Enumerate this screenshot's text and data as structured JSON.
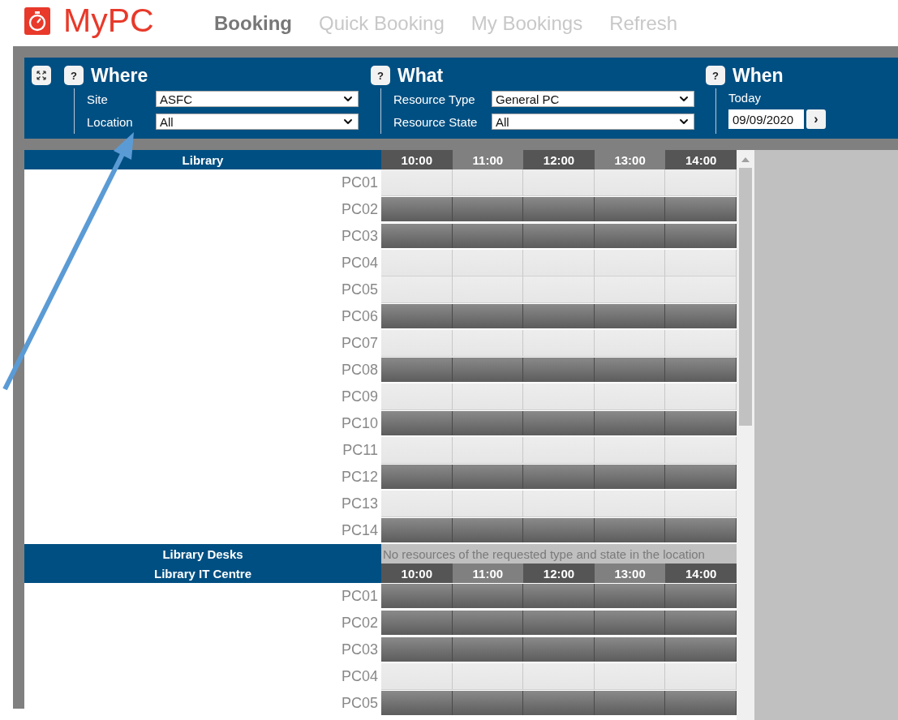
{
  "logo": {
    "text": "MyPC"
  },
  "nav": [
    {
      "label": "Booking",
      "selected": true
    },
    {
      "label": "Quick Booking",
      "selected": false
    },
    {
      "label": "My Bookings",
      "selected": false
    },
    {
      "label": "Refresh",
      "selected": false
    }
  ],
  "filters": [
    {
      "kind": "fields",
      "help": "?",
      "title": "Where",
      "fields": [
        {
          "label": "Site",
          "value": "ASFC"
        },
        {
          "label": "Location",
          "value": "All"
        }
      ]
    },
    {
      "kind": "fields",
      "help": "?",
      "title": "What",
      "fields": [
        {
          "label": "Resource Type",
          "value": "General PC"
        },
        {
          "label": "Resource State",
          "value": "All"
        }
      ]
    },
    {
      "kind": "date",
      "help": "?",
      "title": "When",
      "label": "Today",
      "date": "09/09/2020",
      "next": "›"
    }
  ],
  "locations": [
    {
      "name": "Library",
      "times": [
        "10:00",
        "11:00",
        "12:00",
        "13:00",
        "14:00"
      ],
      "resources": [
        {
          "name": "PC01",
          "available": true
        },
        {
          "name": "PC02",
          "available": false
        },
        {
          "name": "PC03",
          "available": false
        },
        {
          "name": "PC04",
          "available": true
        },
        {
          "name": "PC05",
          "available": true
        },
        {
          "name": "PC06",
          "available": false
        },
        {
          "name": "PC07",
          "available": true
        },
        {
          "name": "PC08",
          "available": false
        },
        {
          "name": "PC09",
          "available": true
        },
        {
          "name": "PC10",
          "available": false
        },
        {
          "name": "PC11",
          "available": true
        },
        {
          "name": "PC12",
          "available": false
        },
        {
          "name": "PC13",
          "available": true
        },
        {
          "name": "PC14",
          "available": false
        }
      ]
    },
    {
      "name": "Library Desks",
      "message": "No resources of the requested type and state in the location"
    },
    {
      "name": "Library IT Centre",
      "times": [
        "10:00",
        "11:00",
        "12:00",
        "13:00",
        "14:00"
      ],
      "resources": [
        {
          "name": "PC01",
          "available": false
        },
        {
          "name": "PC02",
          "available": false
        },
        {
          "name": "PC03",
          "available": false
        },
        {
          "name": "PC04",
          "available": true
        },
        {
          "name": "PC05",
          "available": false
        }
      ]
    }
  ]
}
